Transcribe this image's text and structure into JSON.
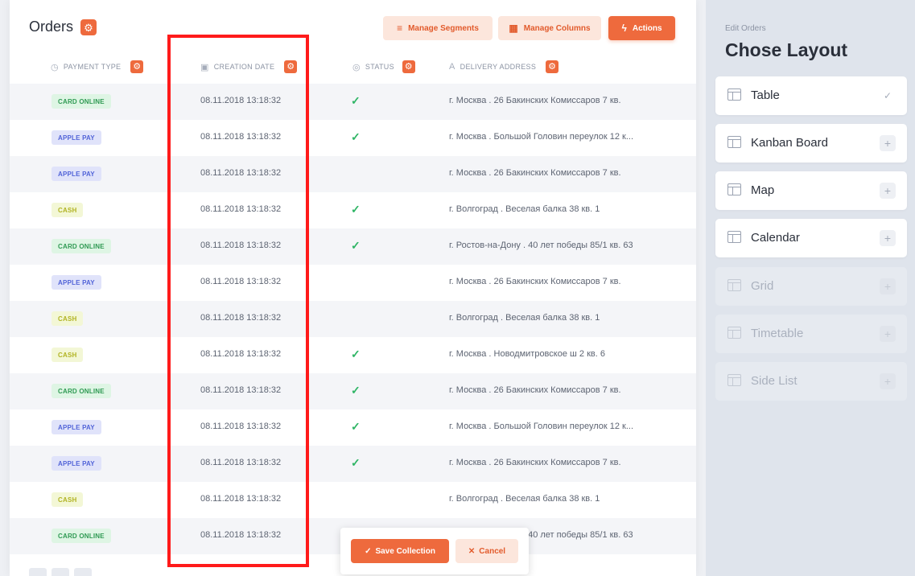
{
  "header": {
    "title": "Orders",
    "gear_icon": "gear-icon",
    "buttons": {
      "manage_segments": "Manage Segments",
      "manage_columns": "Manage Columns",
      "actions": "Actions"
    }
  },
  "table": {
    "columns": {
      "payment_type": "PAYMENT TYPE",
      "creation_date": "CREATION DATE",
      "status": "STATUS",
      "delivery_address": "DELIVERY ADDRESS"
    },
    "rows": [
      {
        "payment": "CARD ONLINE",
        "kind": "card",
        "date": "08.11.2018 13:18:32",
        "status": "✓",
        "address": "г. Москва . 26 Бакинских Комиссаров 7 кв."
      },
      {
        "payment": "APPLE PAY",
        "kind": "apple",
        "date": "08.11.2018 13:18:32",
        "status": "✓",
        "address": "г. Москва . Большой Головин переулок 12 к..."
      },
      {
        "payment": "APPLE PAY",
        "kind": "apple",
        "date": "08.11.2018 13:18:32",
        "status": "",
        "address": "г. Москва . 26 Бакинских Комиссаров 7 кв."
      },
      {
        "payment": "CASH",
        "kind": "cash",
        "date": "08.11.2018 13:18:32",
        "status": "✓",
        "address": "г. Волгоград . Веселая балка 38 кв. 1"
      },
      {
        "payment": "CARD ONLINE",
        "kind": "card",
        "date": "08.11.2018 13:18:32",
        "status": "✓",
        "address": "г. Ростов-на-Дону . 40 лет победы 85/1 кв. 63"
      },
      {
        "payment": "APPLE PAY",
        "kind": "apple",
        "date": "08.11.2018 13:18:32",
        "status": "",
        "address": "г. Москва . 26 Бакинских Комиссаров 7 кв."
      },
      {
        "payment": "CASH",
        "kind": "cash",
        "date": "08.11.2018 13:18:32",
        "status": "",
        "address": "г. Волгоград . Веселая балка 38 кв. 1"
      },
      {
        "payment": "CASH",
        "kind": "cash",
        "date": "08.11.2018 13:18:32",
        "status": "✓",
        "address": "г. Москва . Новодмитровское ш 2 кв. 6"
      },
      {
        "payment": "CARD ONLINE",
        "kind": "card",
        "date": "08.11.2018 13:18:32",
        "status": "✓",
        "address": "г. Москва . 26 Бакинских Комиссаров 7 кв."
      },
      {
        "payment": "APPLE PAY",
        "kind": "apple",
        "date": "08.11.2018 13:18:32",
        "status": "✓",
        "address": "г. Москва . Большой Головин переулок 12 к..."
      },
      {
        "payment": "APPLE PAY",
        "kind": "apple",
        "date": "08.11.2018 13:18:32",
        "status": "✓",
        "address": "г. Москва . 26 Бакинских Комиссаров 7 кв."
      },
      {
        "payment": "CASH",
        "kind": "cash",
        "date": "08.11.2018 13:18:32",
        "status": "",
        "address": "г. Волгоград . Веселая балка 38 кв. 1"
      },
      {
        "payment": "CARD ONLINE",
        "kind": "card",
        "date": "08.11.2018 13:18:32",
        "status": "",
        "address": "г. Ростов-на-Дону . 40 лет победы 85/1 кв. 63"
      }
    ]
  },
  "floating_bar": {
    "save": "Save Collection",
    "cancel": "Cancel"
  },
  "sidebar": {
    "eyebrow": "Edit Orders",
    "title": "Chose Layout",
    "layouts": [
      {
        "name": "Table",
        "state": "selected",
        "action": "✓"
      },
      {
        "name": "Kanban Board",
        "state": "available",
        "action": "+"
      },
      {
        "name": "Map",
        "state": "available",
        "action": "+"
      },
      {
        "name": "Calendar",
        "state": "available",
        "action": "+"
      },
      {
        "name": "Grid",
        "state": "disabled",
        "action": "+"
      },
      {
        "name": "Timetable",
        "state": "disabled",
        "action": "+"
      },
      {
        "name": "Side List",
        "state": "disabled",
        "action": "+"
      }
    ]
  },
  "colors": {
    "accent": "#ee6a3d",
    "accent_light": "#fce6dc",
    "highlight": "#ff1a1a",
    "check": "#2fb565"
  }
}
